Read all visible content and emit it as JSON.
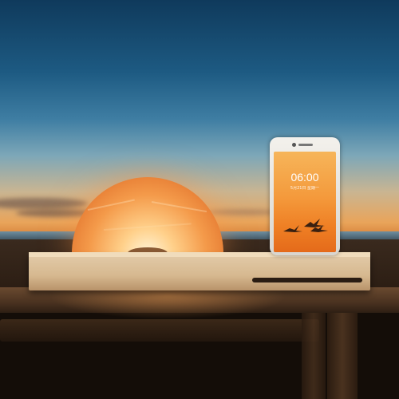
{
  "scene": {
    "description_free": true
  },
  "phone": {
    "time": "06:00",
    "date": "5月21日 星期一"
  },
  "colors": {
    "sky_top": "#0f3a5c",
    "sunset": "#e9a45a",
    "lamp_glow": "#f49a4a",
    "wood": "#d6b88f"
  }
}
